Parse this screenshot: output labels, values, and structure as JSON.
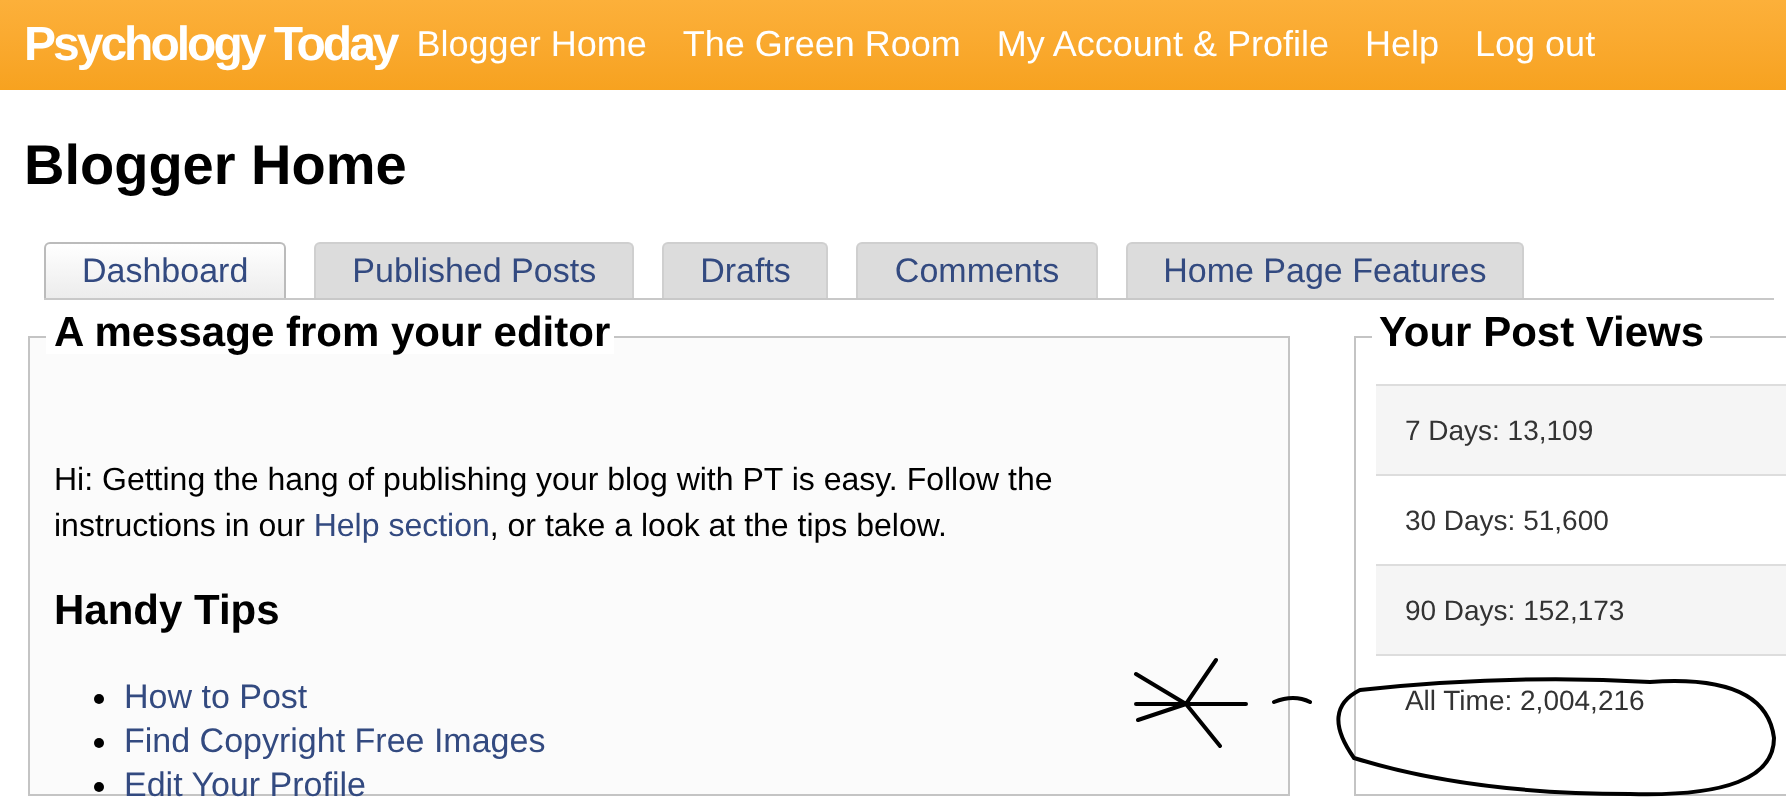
{
  "logo": "Psychology Today",
  "nav": [
    {
      "label": "Blogger Home"
    },
    {
      "label": "The Green Room"
    },
    {
      "label": "My Account & Profile"
    },
    {
      "label": "Help"
    },
    {
      "label": "Log out"
    }
  ],
  "page_title": "Blogger Home",
  "tabs": [
    {
      "label": "Dashboard",
      "selected": true
    },
    {
      "label": "Published Posts",
      "selected": false
    },
    {
      "label": "Drafts",
      "selected": false
    },
    {
      "label": "Comments",
      "selected": false
    },
    {
      "label": "Home Page Features",
      "selected": false
    }
  ],
  "message": {
    "title": "A message from your editor",
    "text_before": "Hi:  Getting the hang of publishing your blog with PT is easy. Follow the instructions in our ",
    "link": "Help section",
    "text_after": ", or take a look at the tips below."
  },
  "tips": {
    "title": "Handy Tips",
    "items": [
      "How to Post",
      "Find Copyright Free Images",
      "Edit Your Profile"
    ]
  },
  "post_views": {
    "title": "Your Post Views",
    "rows": [
      "7 Days: 13,109",
      "30 Days: 51,600",
      "90 Days: 152,173",
      "All Time: 2,004,216"
    ]
  }
}
